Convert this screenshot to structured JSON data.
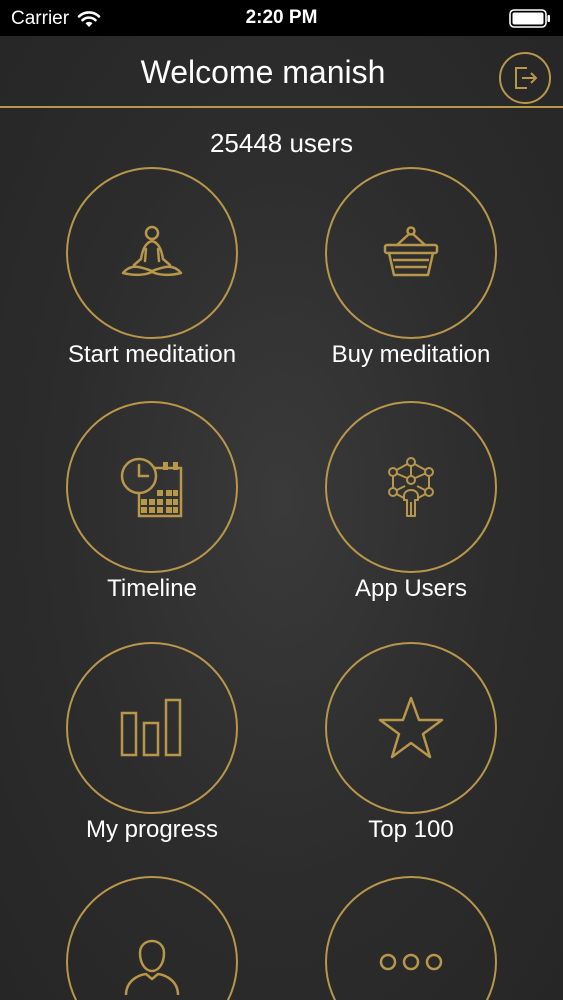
{
  "status_bar": {
    "carrier": "Carrier",
    "time": "2:20 PM"
  },
  "header": {
    "title": "Welcome manish",
    "logout_icon": "logout-icon"
  },
  "user_count": "25448 users",
  "tiles": [
    {
      "label": "Start meditation",
      "icon": "meditation-icon"
    },
    {
      "label": "Buy meditation",
      "icon": "shopping-basket-icon"
    },
    {
      "label": "Timeline",
      "icon": "clock-calendar-icon"
    },
    {
      "label": "App Users",
      "icon": "network-users-icon"
    },
    {
      "label": "My progress",
      "icon": "bar-chart-icon"
    },
    {
      "label": "Top 100",
      "icon": "star-icon"
    },
    {
      "label": "",
      "icon": "profile-icon"
    },
    {
      "label": "",
      "icon": "more-icon"
    }
  ],
  "colors": {
    "accent": "#b8964a",
    "background": "#2e2e2e",
    "status_bar": "#000000",
    "text": "#ffffff"
  }
}
